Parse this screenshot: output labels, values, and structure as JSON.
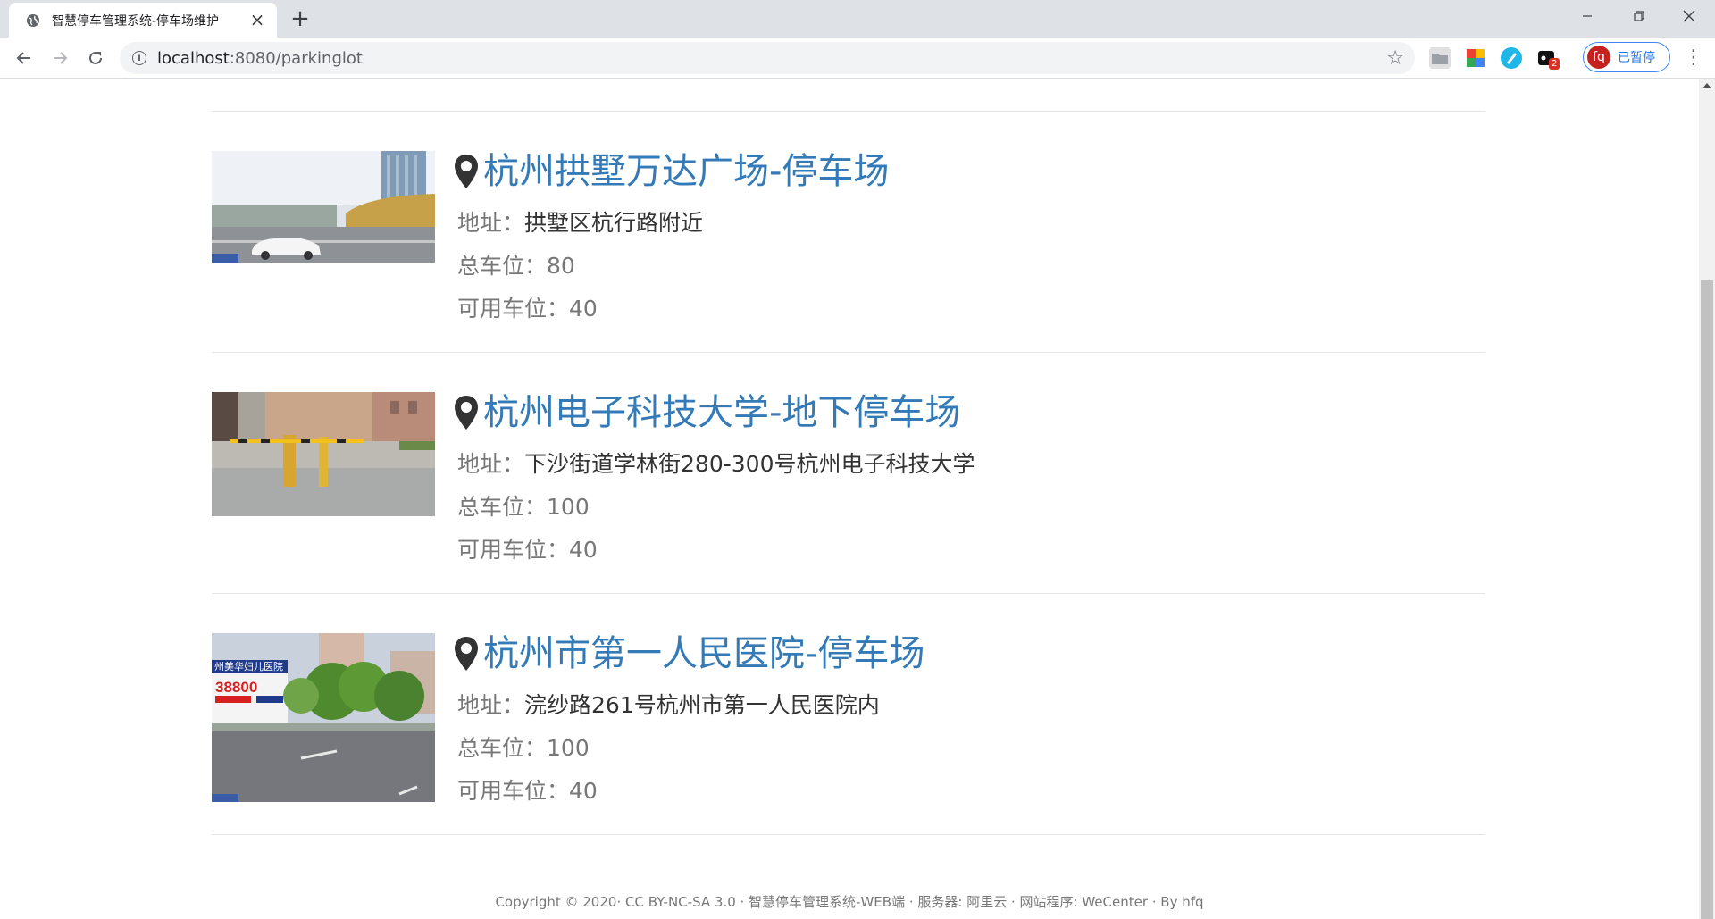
{
  "browser": {
    "tab_title": "智慧停车管理系统-停车场维护",
    "url_host": "localhost",
    "url_rest": ":8080/parkinglot",
    "profile_initials": "fq",
    "profile_status": "已暂停",
    "extension_badge": "2"
  },
  "labels": {
    "address": "地址：",
    "total": "总车位：",
    "available": "可用车位："
  },
  "lots": [
    {
      "title": "杭州拱墅万达广场-停车场",
      "address": "拱墅区杭行路附近",
      "total": "80",
      "available": "40"
    },
    {
      "title": "杭州电子科技大学-地下停车场",
      "address": "下沙街道学林街280-300号杭州电子科技大学",
      "total": "100",
      "available": "40"
    },
    {
      "title": "杭州市第一人民医院-停车场",
      "address": "浣纱路261号杭州市第一人民医院内",
      "total": "100",
      "available": "40",
      "image_text": "38800"
    }
  ],
  "footer": "Copyright © 2020· CC BY-NC-SA 3.0 · 智慧停车管理系统-WEB端 · 服务器: 阿里云 · 网站程序: WeCenter · By hfq"
}
